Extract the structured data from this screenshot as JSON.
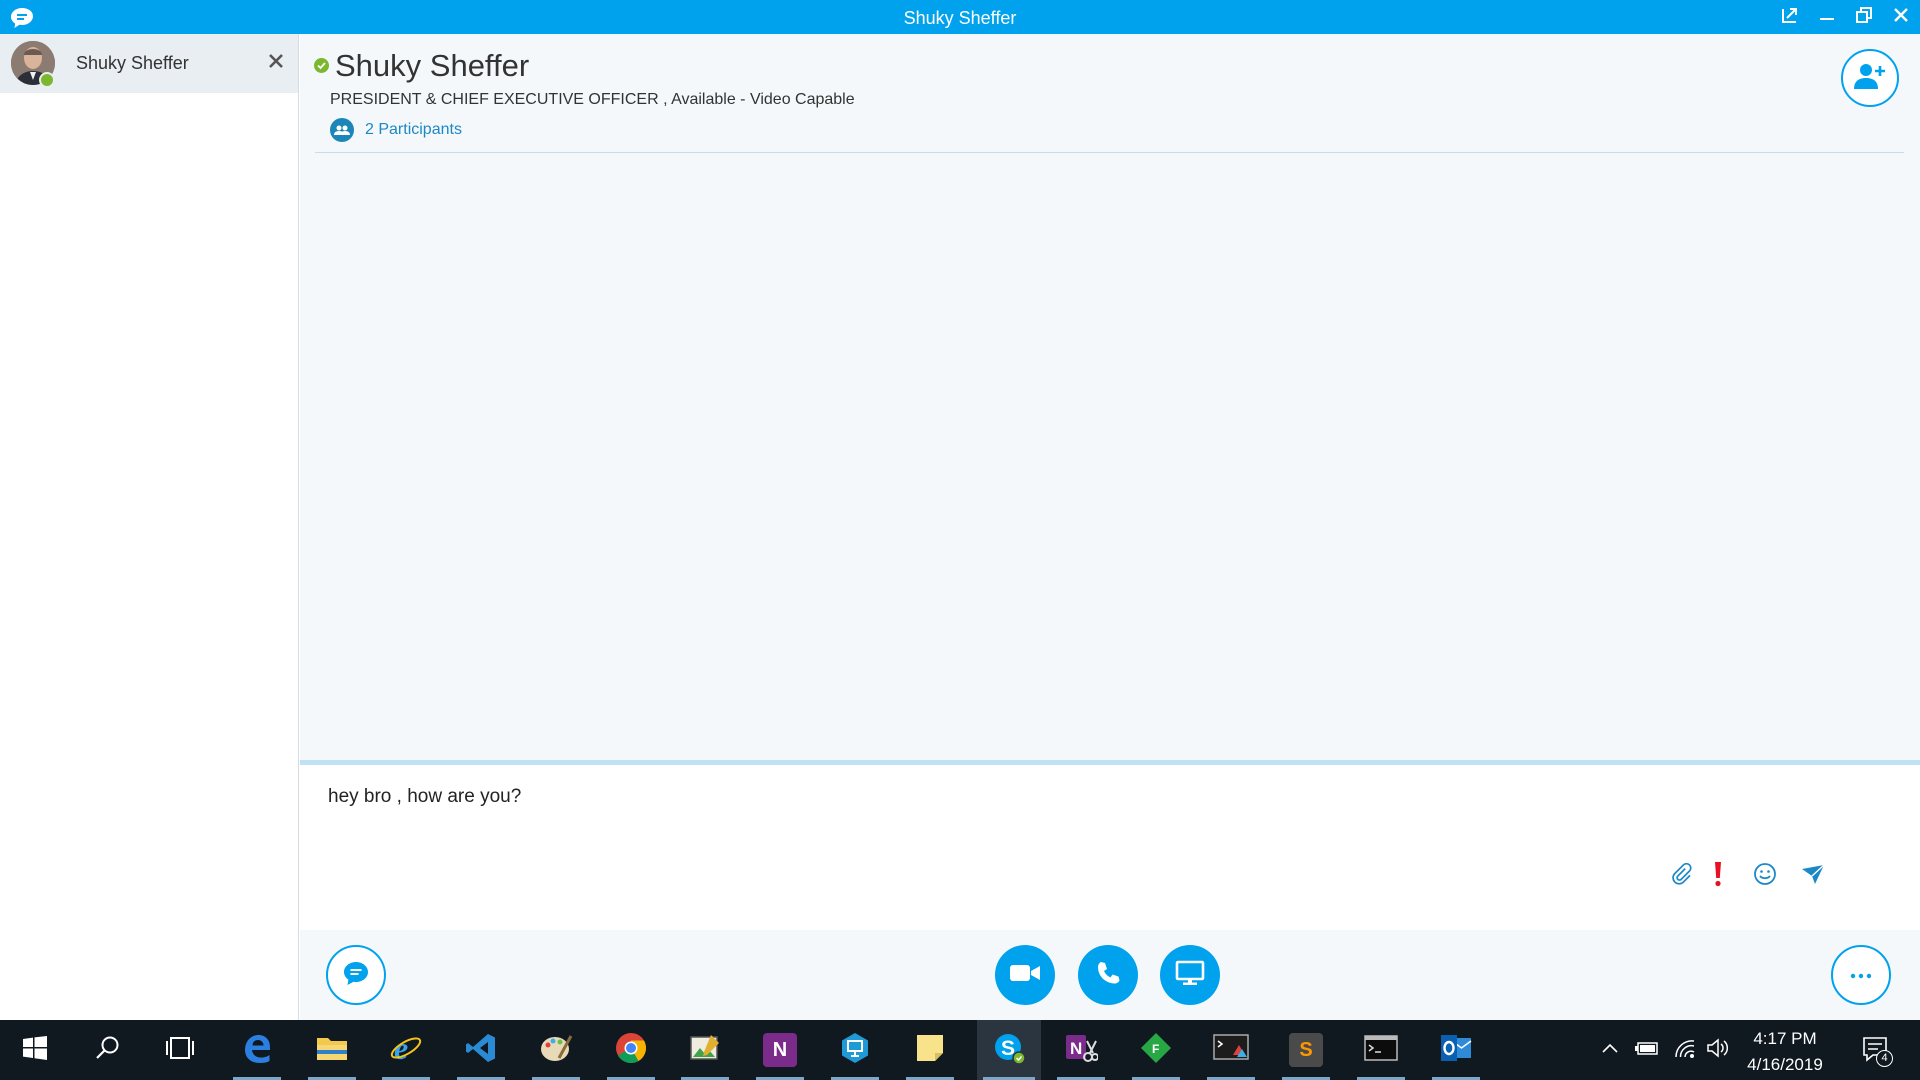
{
  "window": {
    "title": "Shuky Sheffer"
  },
  "sidebar": {
    "conversations": [
      {
        "name": "Shuky Sheffer",
        "presence": "available"
      }
    ]
  },
  "header": {
    "contact_name": "Shuky Sheffer",
    "contact_status": "PRESIDENT & CHIEF EXECUTIVE OFFICER , Available - Video Capable",
    "participants_label": "2 Participants"
  },
  "compose": {
    "message_text": "hey bro , how are you?"
  },
  "taskbar": {
    "apps": [
      "start-icon",
      "search-icon",
      "task-view-icon",
      "edge-icon",
      "file-explorer-icon",
      "internet-explorer-icon",
      "vscode-icon",
      "paint-icon",
      "chrome-icon",
      "image-viewer-icon",
      "onenote-icon",
      "remote-desktop-icon",
      "sticky-notes-icon",
      "skype-for-business-icon",
      "onenote-clipper-icon",
      "green-app-icon",
      "terminal-app-icon",
      "sublime-text-icon",
      "command-prompt-icon",
      "outlook-icon"
    ],
    "clock_time": "4:17 PM",
    "clock_date": "4/16/2019",
    "notification_count": "4"
  },
  "colors": {
    "accent": "#00a2ed",
    "presence_available": "#7cb82f",
    "urgent": "#e81123",
    "taskbar_bg": "#101820"
  }
}
